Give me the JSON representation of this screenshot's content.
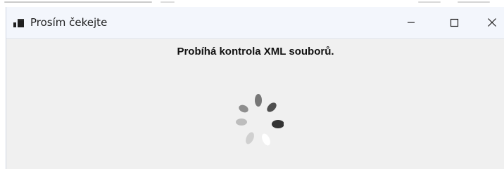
{
  "window": {
    "title": "Prosím čekejte"
  },
  "content": {
    "message": "Probíhá kontrola XML souborů."
  },
  "icons": {
    "app": "app-window-icon",
    "minimize": "minimize-icon",
    "maximize": "maximize-icon",
    "close": "close-icon",
    "loading": "loading-spinner-icon"
  },
  "colors": {
    "title_bar": "#f3f6fc",
    "window_background": "#f0f0f0",
    "title_text": "#1f1f1f",
    "message_text": "#111111",
    "spinner_dark": "#333333",
    "spinner_mid": "#707070",
    "spinner_light": "#b6b6b6",
    "spinner_highlight": "#ffffff"
  }
}
